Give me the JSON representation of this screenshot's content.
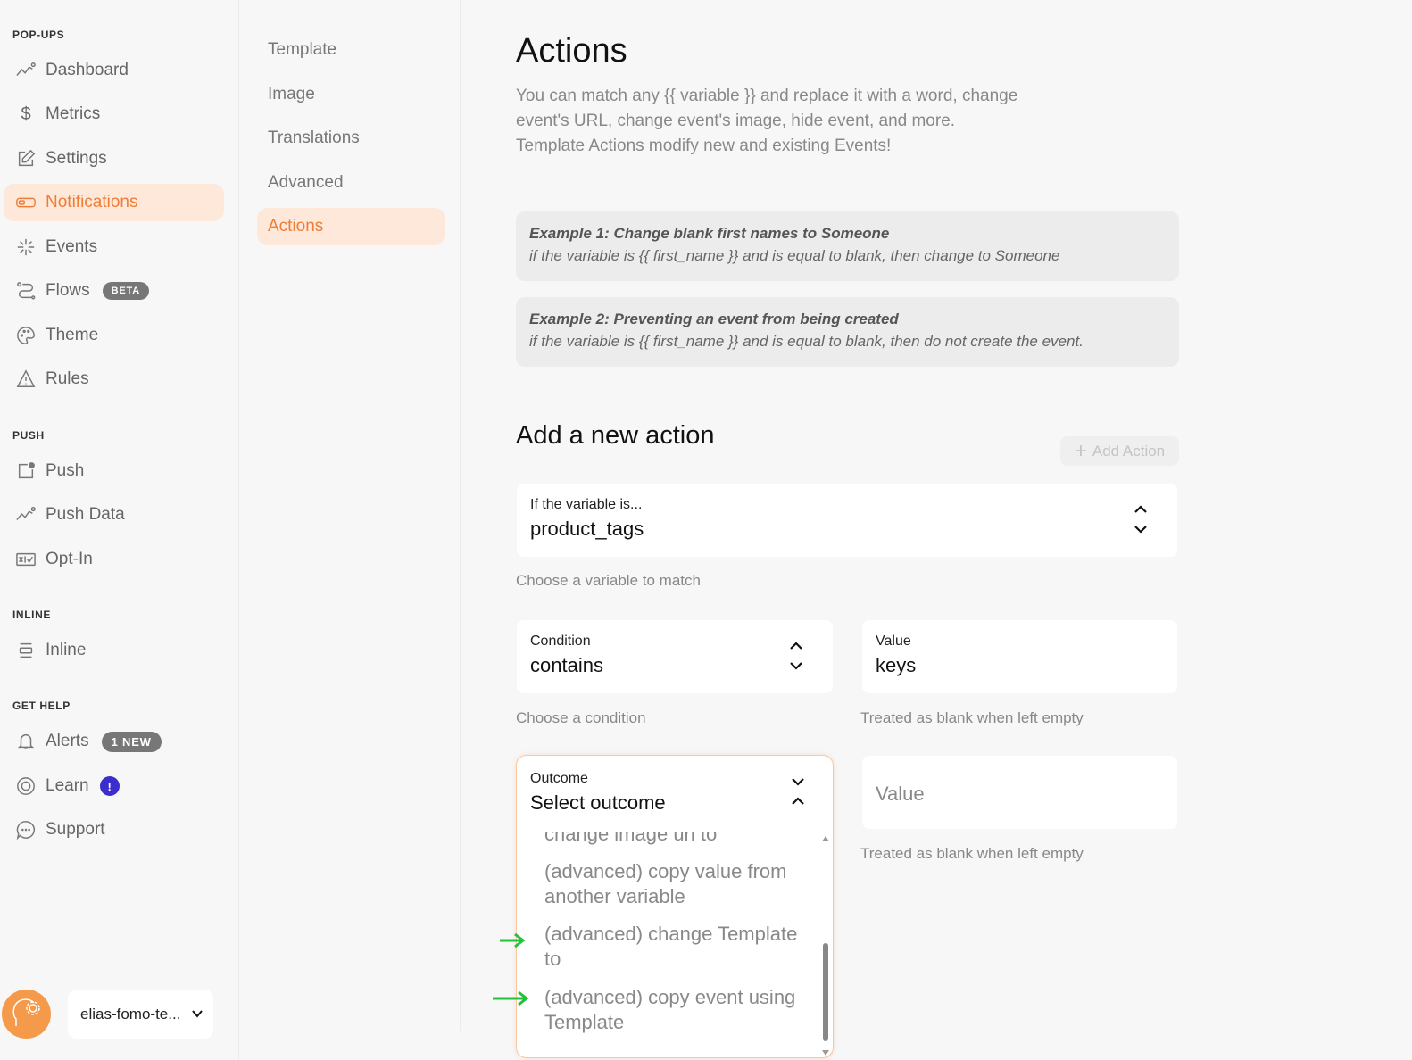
{
  "sidebar": {
    "sections": {
      "popups": "POP-UPS",
      "push": "PUSH",
      "inline": "INLINE",
      "help": "GET HELP"
    },
    "items": {
      "dashboard": "Dashboard",
      "metrics": "Metrics",
      "settings": "Settings",
      "notifications": "Notifications",
      "events": "Events",
      "flows": "Flows",
      "flows_badge": "BETA",
      "theme": "Theme",
      "rules": "Rules",
      "push": "Push",
      "push_data": "Push Data",
      "optin": "Opt-In",
      "inline": "Inline",
      "alerts": "Alerts",
      "alerts_badge": "1 NEW",
      "learn": "Learn",
      "learn_badge": "!",
      "support": "Support"
    },
    "account": "elias-fomo-te..."
  },
  "subnav": {
    "template": "Template",
    "image": "Image",
    "translations": "Translations",
    "advanced": "Advanced",
    "actions": "Actions"
  },
  "main": {
    "title": "Actions",
    "description_lines": [
      "You can match any {{ variable }} and replace it with a word, change",
      "event's URL, change event's image, hide event, and more.",
      "Template Actions modify new and existing Events!"
    ],
    "examples": [
      {
        "title": "Example 1: Change blank first names to Someone",
        "text": "if the variable is {{ first_name }} and is equal to blank, then change to Someone"
      },
      {
        "title": "Example 2: Preventing an event from being created",
        "text": "if the variable is {{ first_name }} and is equal to blank, then do not create the event."
      }
    ],
    "new_action_title": "Add a new action",
    "add_action_label": "Add Action",
    "variable_field": {
      "label": "If the variable is...",
      "value": "product_tags",
      "help": "Choose a variable to match"
    },
    "condition_field": {
      "label": "Condition",
      "value": "contains",
      "help": "Choose a condition"
    },
    "value_field": {
      "label": "Value",
      "value": "keys",
      "help": "Treated as blank when left empty"
    },
    "outcome_field": {
      "label": "Outcome",
      "value": "Select outcome",
      "options": [
        "change image url to",
        "(advanced) copy value from another variable",
        "(advanced) change Template to",
        "(advanced) copy event using Template"
      ]
    },
    "outcome_value_field": {
      "placeholder": "Value",
      "help": "Treated as blank when left empty"
    }
  },
  "colors": {
    "accent": "#f07d37",
    "active_bg": "#fde8d9",
    "annotation_arrow": "#22c33a"
  }
}
